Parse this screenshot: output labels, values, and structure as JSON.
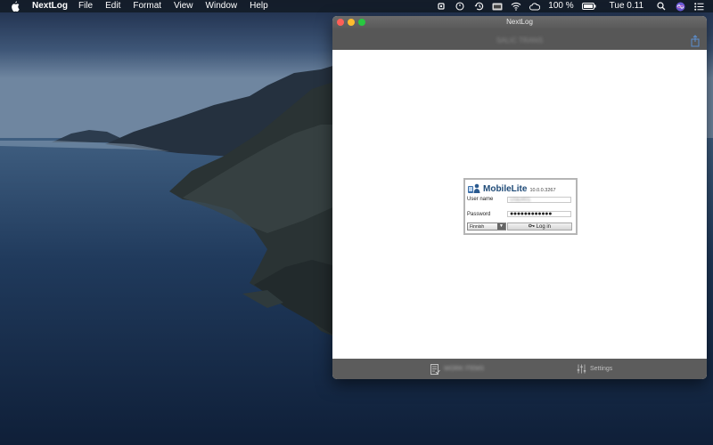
{
  "menubar": {
    "app_name": "NextLog",
    "menus": [
      "File",
      "Edit",
      "Format",
      "View",
      "Window",
      "Help"
    ],
    "battery": "100 %",
    "clock": "Tue 0.11",
    "icons": [
      "apple-icon",
      "cpu-icon",
      "compass-icon",
      "time-machine-icon",
      "display-icon",
      "wifi-icon",
      "cloud-icon",
      "battery-icon",
      "search-icon",
      "siri-icon",
      "notification-center-icon"
    ]
  },
  "window": {
    "title": "NextLog",
    "toolbar_title": "SALIC TRANS",
    "bottom_tabs": [
      {
        "label": "WORK ITEMS",
        "icon": "checklist-icon"
      },
      {
        "label": "Settings",
        "icon": "sliders-icon"
      }
    ]
  },
  "login": {
    "brand": "MobileLite",
    "version": "10.0.0.3267",
    "username_label": "User name",
    "username_value": "USER01",
    "password_label": "Password",
    "password_value": "●●●●●●●●●●●●",
    "language": "Finnish",
    "login_button": "Log in"
  },
  "colors": {
    "close": "#fe5f57",
    "minimize": "#febc2e",
    "zoom": "#28c840",
    "brand": "#1e4a77"
  }
}
